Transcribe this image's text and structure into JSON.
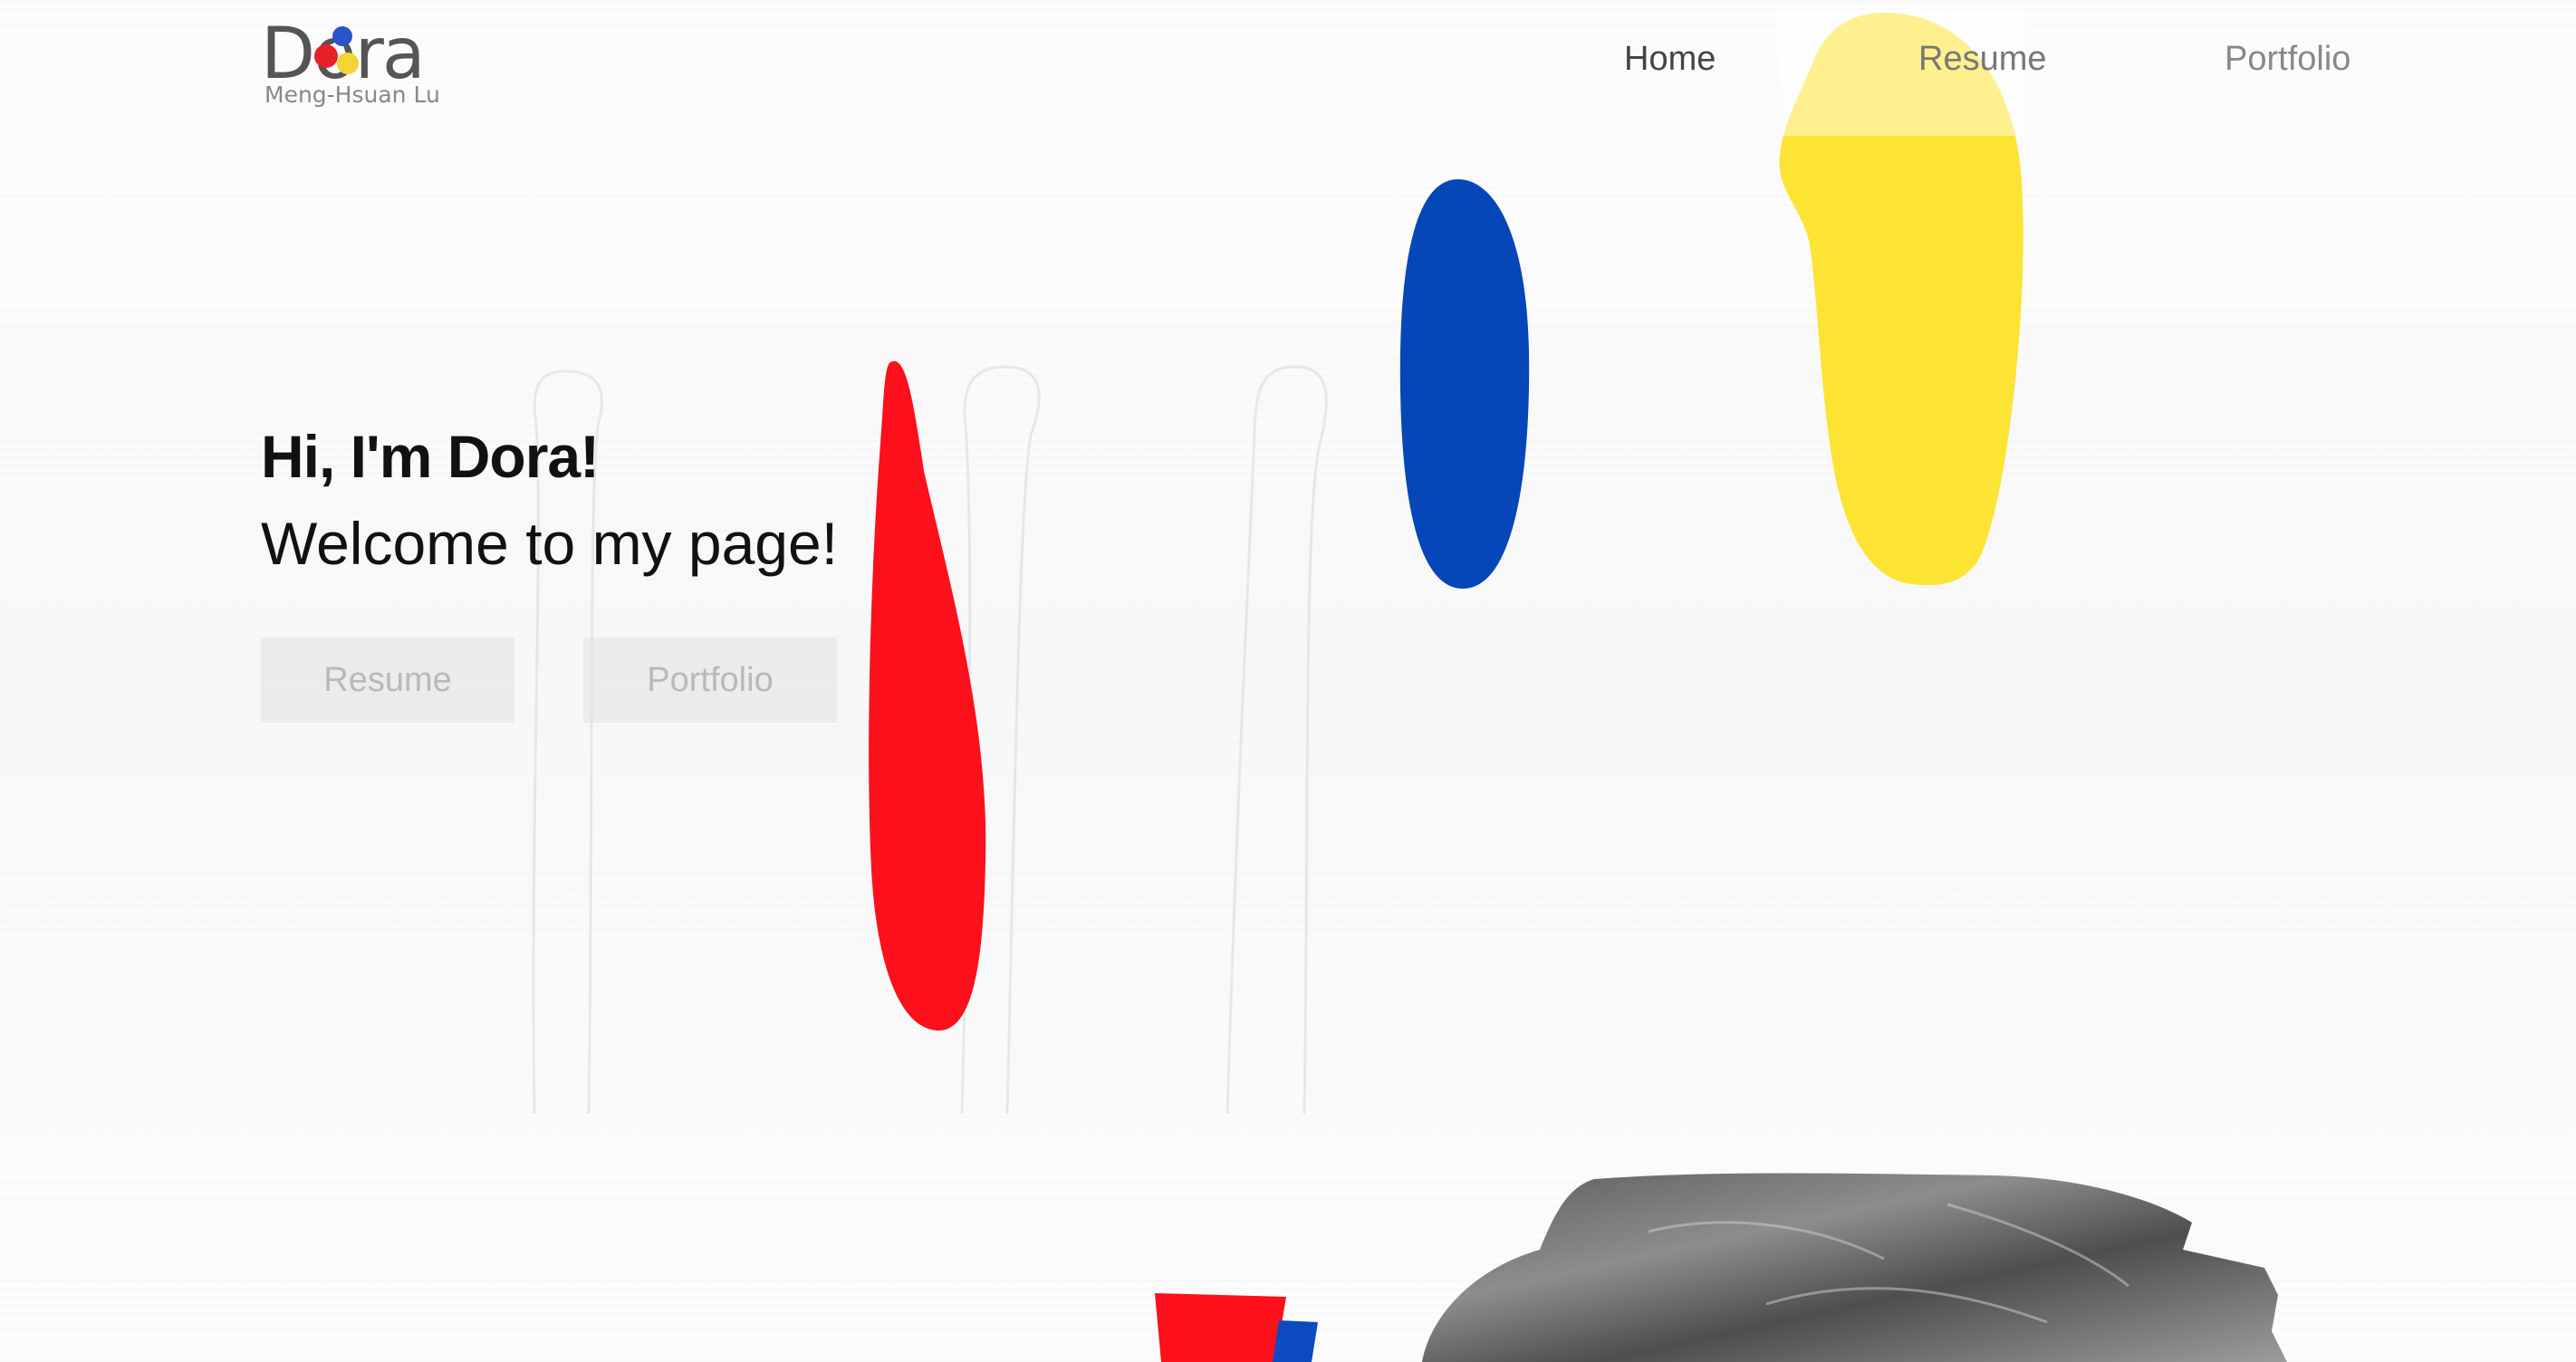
{
  "brand": {
    "logo_text": "Dora",
    "logo_subtitle": "Meng-Hsuan Lu",
    "dot_colors": [
      "#e8202a",
      "#2a55c8",
      "#f2d534"
    ]
  },
  "nav": {
    "home": "Home",
    "resume": "Resume",
    "portfolio": "Portfolio"
  },
  "hero": {
    "greeting": "Hi, I'm Dora!",
    "welcome": "Welcome to my page!",
    "resume_button": "Resume",
    "portfolio_button": "Portfolio"
  },
  "colors": {
    "red": "#fb101b",
    "blue": "#0547b8",
    "yellow": "#fde434"
  }
}
